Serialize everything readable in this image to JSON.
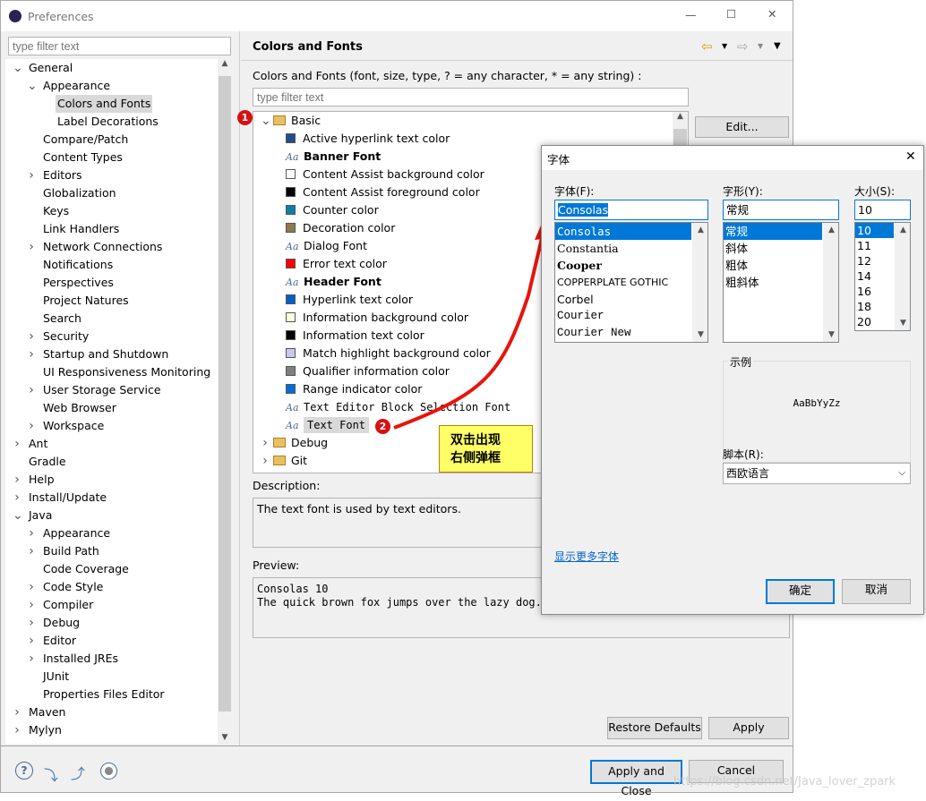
{
  "window": {
    "title": "Preferences",
    "minimize": "—",
    "maximize": "☐",
    "close": "✕"
  },
  "left": {
    "filter_placeholder": "type filter text",
    "tree": [
      {
        "label": "General",
        "level": 0,
        "arrow": "down"
      },
      {
        "label": "Appearance",
        "level": 1,
        "arrow": "down"
      },
      {
        "label": "Colors and Fonts",
        "level": 2,
        "arrow": "",
        "selected": true
      },
      {
        "label": "Label Decorations",
        "level": 2,
        "arrow": ""
      },
      {
        "label": "Compare/Patch",
        "level": 1,
        "arrow": ""
      },
      {
        "label": "Content Types",
        "level": 1,
        "arrow": ""
      },
      {
        "label": "Editors",
        "level": 1,
        "arrow": "right"
      },
      {
        "label": "Globalization",
        "level": 1,
        "arrow": ""
      },
      {
        "label": "Keys",
        "level": 1,
        "arrow": ""
      },
      {
        "label": "Link Handlers",
        "level": 1,
        "arrow": ""
      },
      {
        "label": "Network Connections",
        "level": 1,
        "arrow": "right"
      },
      {
        "label": "Notifications",
        "level": 1,
        "arrow": ""
      },
      {
        "label": "Perspectives",
        "level": 1,
        "arrow": ""
      },
      {
        "label": "Project Natures",
        "level": 1,
        "arrow": ""
      },
      {
        "label": "Search",
        "level": 1,
        "arrow": ""
      },
      {
        "label": "Security",
        "level": 1,
        "arrow": "right"
      },
      {
        "label": "Startup and Shutdown",
        "level": 1,
        "arrow": "right"
      },
      {
        "label": "UI Responsiveness Monitoring",
        "level": 1,
        "arrow": ""
      },
      {
        "label": "User Storage Service",
        "level": 1,
        "arrow": "right"
      },
      {
        "label": "Web Browser",
        "level": 1,
        "arrow": ""
      },
      {
        "label": "Workspace",
        "level": 1,
        "arrow": "right"
      },
      {
        "label": "Ant",
        "level": 0,
        "arrow": "right"
      },
      {
        "label": "Gradle",
        "level": 0,
        "arrow": ""
      },
      {
        "label": "Help",
        "level": 0,
        "arrow": "right"
      },
      {
        "label": "Install/Update",
        "level": 0,
        "arrow": "right"
      },
      {
        "label": "Java",
        "level": 0,
        "arrow": "down"
      },
      {
        "label": "Appearance",
        "level": 1,
        "arrow": "right"
      },
      {
        "label": "Build Path",
        "level": 1,
        "arrow": "right"
      },
      {
        "label": "Code Coverage",
        "level": 1,
        "arrow": ""
      },
      {
        "label": "Code Style",
        "level": 1,
        "arrow": "right"
      },
      {
        "label": "Compiler",
        "level": 1,
        "arrow": "right"
      },
      {
        "label": "Debug",
        "level": 1,
        "arrow": "right"
      },
      {
        "label": "Editor",
        "level": 1,
        "arrow": "right"
      },
      {
        "label": "Installed JREs",
        "level": 1,
        "arrow": "right"
      },
      {
        "label": "JUnit",
        "level": 1,
        "arrow": ""
      },
      {
        "label": "Properties Files Editor",
        "level": 1,
        "arrow": ""
      },
      {
        "label": "Maven",
        "level": 0,
        "arrow": "right"
      },
      {
        "label": "Mylyn",
        "level": 0,
        "arrow": "right"
      }
    ]
  },
  "main": {
    "title": "Colors and Fonts",
    "nav": {
      "back": "⇦",
      "forward": "⇨",
      "menu": "▼"
    },
    "intro": "Colors and Fonts (font, size, type, ? = any character, * = any string) :",
    "filter_placeholder": "type filter text",
    "tree": [
      {
        "label": "Basic",
        "kind": "folder",
        "level": 0,
        "arrow": "down"
      },
      {
        "label": "Active hyperlink text color",
        "kind": "color",
        "color": "#1f4e8c"
      },
      {
        "label": "Banner Font",
        "kind": "font",
        "bold": true
      },
      {
        "label": "Content Assist background color",
        "kind": "color",
        "color": "#ffffff"
      },
      {
        "label": "Content Assist foreground color",
        "kind": "color",
        "color": "#000000"
      },
      {
        "label": "Counter color",
        "kind": "color",
        "color": "#0a7fa8"
      },
      {
        "label": "Decoration color",
        "kind": "color",
        "color": "#8c7a4c"
      },
      {
        "label": "Dialog Font",
        "kind": "font"
      },
      {
        "label": "Error text color",
        "kind": "color",
        "color": "#ff0000"
      },
      {
        "label": "Header Font",
        "kind": "font",
        "bold": true
      },
      {
        "label": "Hyperlink text color",
        "kind": "color",
        "color": "#0060c8"
      },
      {
        "label": "Information background color",
        "kind": "color",
        "color": "#ffffe1"
      },
      {
        "label": "Information text color",
        "kind": "color",
        "color": "#000000"
      },
      {
        "label": "Match highlight background color",
        "kind": "color",
        "color": "#c8c8f0"
      },
      {
        "label": "Qualifier information color",
        "kind": "color",
        "color": "#808080"
      },
      {
        "label": "Range indicator color",
        "kind": "color",
        "color": "#0070d8"
      },
      {
        "label": "Text Editor Block Selection Font",
        "kind": "font",
        "mono": true
      },
      {
        "label": "Text Font",
        "kind": "font",
        "mono": true,
        "selected": true
      },
      {
        "label": "Debug",
        "kind": "folder",
        "level": 0,
        "arrow": "right"
      },
      {
        "label": "Git",
        "kind": "folder",
        "level": 0,
        "arrow": "right"
      }
    ],
    "edit_button": "Edit...",
    "description_label": "Description:",
    "description": "The text font is used by text editors.",
    "preview_label": "Preview:",
    "preview_line1": "Consolas 10",
    "preview_line2": "The quick brown fox jumps over the lazy dog.",
    "restore_defaults": "Restore Defaults",
    "apply": "Apply"
  },
  "footer": {
    "apply_close": "Apply and Close",
    "cancel": "Cancel"
  },
  "annotations": {
    "marker1": "1",
    "marker2": "2",
    "callout_line1": "双击出现",
    "callout_line2": "右侧弹框",
    "arrow_color": "#e8140c",
    "callout_bg": "#ffff66"
  },
  "font_dialog": {
    "title": "字体",
    "close": "✕",
    "font_label": "字体(F):",
    "font_value": "Consolas",
    "fonts": [
      "Consolas",
      "Constantia",
      "Cooper",
      "COPPERPLATE GOTHIC",
      "Corbel",
      "Courier",
      "Courier New"
    ],
    "style_label": "字形(Y):",
    "style_value": "常规",
    "styles": [
      "常规",
      "斜体",
      "粗体",
      "粗斜体"
    ],
    "size_label": "大小(S):",
    "size_value": "10",
    "sizes": [
      "10",
      "11",
      "12",
      "14",
      "16",
      "18",
      "20"
    ],
    "sample_label": "示例",
    "sample_text": "AaBbYyZz",
    "script_label": "脚本(R):",
    "script_value": "西欧语言",
    "more_fonts": "显示更多字体",
    "ok": "确定",
    "cancel": "取消"
  },
  "watermark": "https://blog.csdn.net/Java_lover_zpark"
}
